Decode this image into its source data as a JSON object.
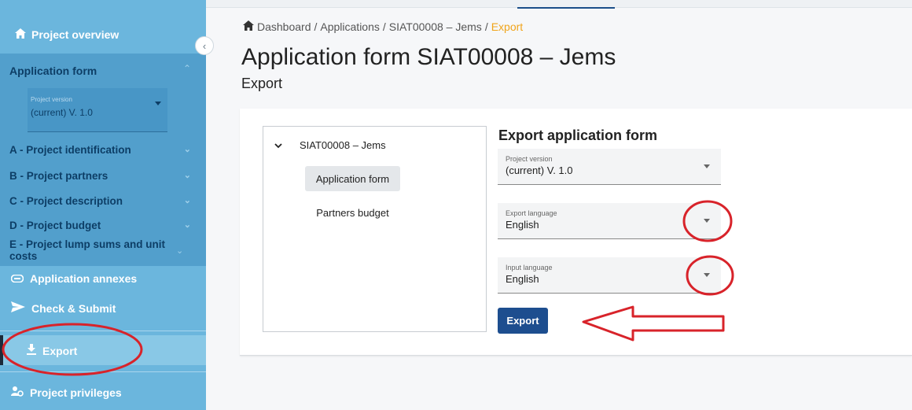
{
  "sidebar": {
    "project_overview": "Project overview",
    "section_title": "Application form",
    "version": {
      "label": "Project version",
      "value": "(current) V. 1.0"
    },
    "items": [
      {
        "label": "A - Project identification"
      },
      {
        "label": "B - Project partners"
      },
      {
        "label": "C - Project description"
      },
      {
        "label": "D - Project budget"
      },
      {
        "label": "E - Project lump sums and unit costs"
      }
    ],
    "annexes": "Application annexes",
    "check_submit": "Check & Submit",
    "export": "Export",
    "privileges": "Project privileges"
  },
  "breadcrumb": {
    "dashboard": "Dashboard",
    "sep": "/",
    "applications": "Applications",
    "project": "SIAT00008 – Jems",
    "current": "Export"
  },
  "page": {
    "title": "Application form SIAT00008 – Jems",
    "subtitle": "Export"
  },
  "tree": {
    "root": "SIAT00008 – Jems",
    "items": [
      "Application form",
      "Partners budget"
    ],
    "selected_index": 0
  },
  "export_form": {
    "title": "Export application form",
    "project_version": {
      "label": "Project version",
      "value": "(current) V. 1.0"
    },
    "export_language": {
      "label": "Export language",
      "value": "English"
    },
    "input_language": {
      "label": "Input language",
      "value": "English"
    },
    "button": "Export"
  },
  "colors": {
    "sidebar": "#6bb6dd",
    "sidebar_section": "#529fcc",
    "primary_button": "#1d4e8f",
    "breadcrumb_active": "#f0a41a",
    "annotation_red": "#d8232a"
  }
}
